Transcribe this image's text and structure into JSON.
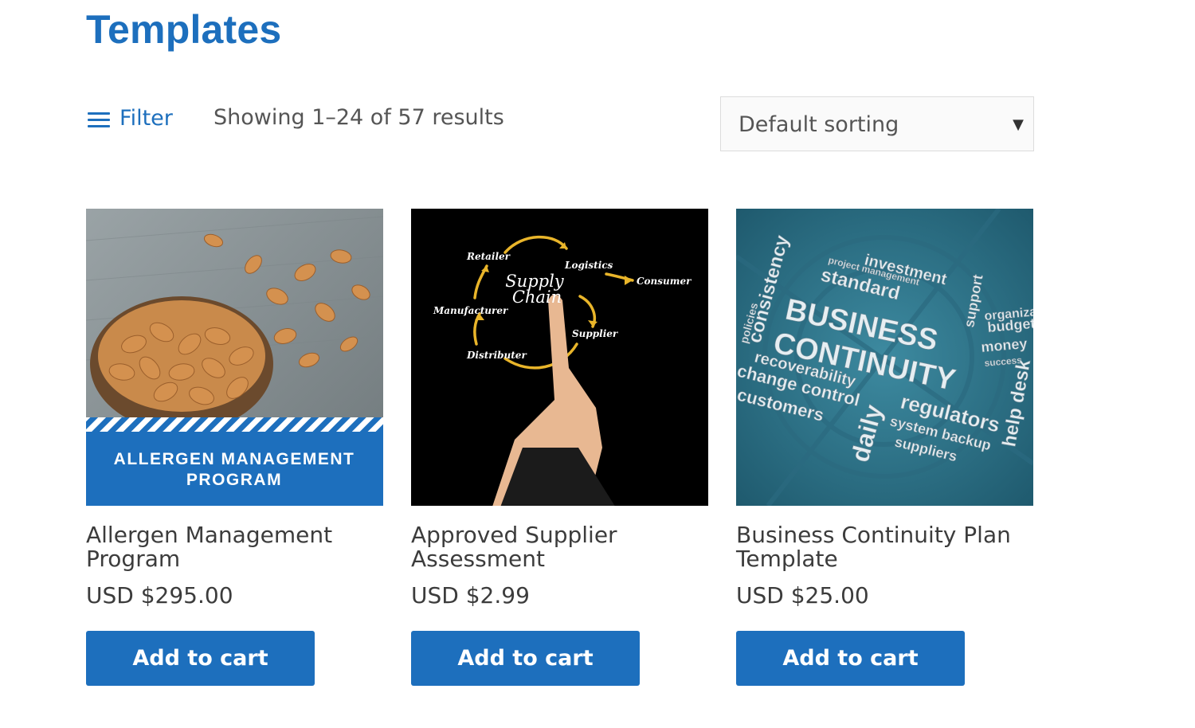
{
  "page": {
    "title": "Templates"
  },
  "toolbar": {
    "filter_label": "Filter",
    "result_count": "Showing 1–24 of 57 results",
    "sorting": {
      "selected": "Default sorting"
    }
  },
  "products": [
    {
      "title": "Allergen Management Program",
      "price": "USD $295.00",
      "button": "Add to cart",
      "image_overlay": [
        "ALLERGEN MANAGEMENT",
        "PROGRAM"
      ]
    },
    {
      "title": "Approved Supplier Assessment",
      "price": "USD $2.99",
      "button": "Add to cart",
      "image_words": [
        "Supply",
        "Chain",
        "Retailer",
        "Logistics",
        "Consumer",
        "Manufacturer",
        "Supplier",
        "Distributer"
      ]
    },
    {
      "title": "Business Continuity Plan Template",
      "price": "USD $25.00",
      "button": "Add to cart",
      "image_words": [
        "BUSINESS",
        "CONTINUITY",
        "consistency",
        "investment",
        "project management",
        "standard",
        "support",
        "budget",
        "money",
        "success",
        "recoverability",
        "change control",
        "customers",
        "daily",
        "regulators",
        "system backup",
        "suppliers",
        "help desk",
        "policies",
        "organization"
      ]
    }
  ],
  "colors": {
    "accent": "#1d6fbd",
    "text": "#3c3c3c",
    "muted": "#555555"
  }
}
